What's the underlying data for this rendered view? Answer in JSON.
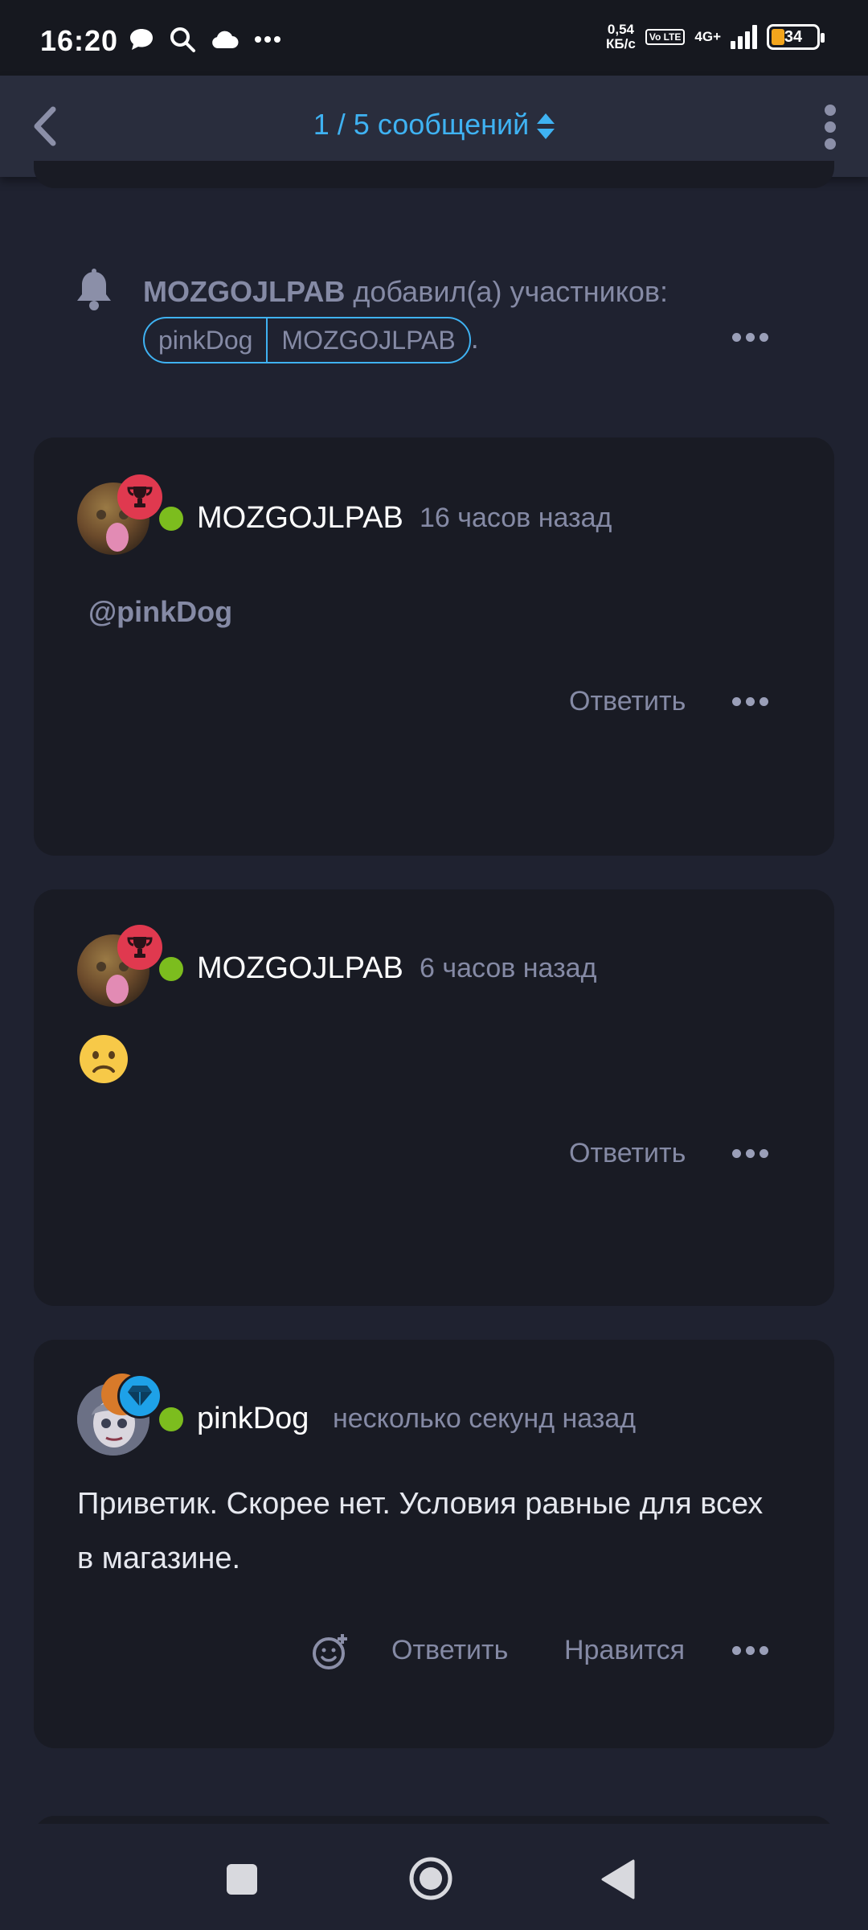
{
  "status_bar": {
    "time": "16:20",
    "net_speed_value": "0,54",
    "net_speed_unit": "КБ/с",
    "volte": "Vo LTE",
    "network": "4G+",
    "battery": "34"
  },
  "top_bar": {
    "title": "1 / 5 сообщений"
  },
  "system_message": {
    "user": "MOZGOJLPAB",
    "text": "добавил(а) участников:",
    "participants": [
      "pinkDog",
      "MOZGOJLPAB"
    ],
    "trailing": "."
  },
  "posts": [
    {
      "username": "MOZGOJLPAB",
      "time": "16 часов назад",
      "mention": "@pinkDog",
      "reply_label": "Ответить"
    },
    {
      "username": "MOZGOJLPAB",
      "time": "6 часов назад",
      "emoji": "🙁",
      "reply_label": "Ответить"
    },
    {
      "username": "pinkDog",
      "time": "несколько секунд назад",
      "text": "Приветик. Скорее нет. Условия равные для всех в магазине.",
      "reply_label": "Ответить",
      "like_label": "Нравится"
    }
  ],
  "colors": {
    "accent": "#3fb2f2",
    "online": "#7cbd1e",
    "trophy_badge": "#e0394f",
    "diamond_badge": "#1ea1e8",
    "card_bg": "#191b24",
    "page_bg": "#1f2230"
  },
  "icons": {
    "back": "chevron-left-icon",
    "sort": "sort-arrows-icon",
    "menu": "kebab-menu-icon",
    "bell": "bell-icon",
    "trophy": "trophy-icon",
    "diamond": "diamond-icon",
    "add_reaction": "add-reaction-icon",
    "more": "more-dots-icon"
  }
}
